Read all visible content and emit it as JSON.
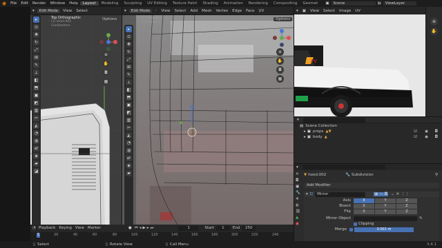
{
  "topbar": {
    "menus": [
      "File",
      "Edit",
      "Render",
      "Window",
      "Help"
    ],
    "workspaces": [
      "Layout",
      "Modeling",
      "Sculpting",
      "UV Editing",
      "Texture Paint",
      "Shading",
      "Animation",
      "Rendering",
      "Compositing",
      "Geomet"
    ],
    "active_workspace": "Layout",
    "scene_label": "Scene",
    "view_layer_label": "ViewLayer"
  },
  "left_viewport": {
    "header": [
      "Edit Mode",
      "View",
      "Select"
    ],
    "title": "Top Orthographic",
    "subtitle1": "(1) hood.002",
    "subtitle2": "Centimeters",
    "options_label": "Options"
  },
  "mid_viewport": {
    "header": [
      "Edit Mode",
      "View",
      "Select",
      "Add",
      "Mesh",
      "Vertex",
      "Edge",
      "Face",
      "UV"
    ],
    "subtitle1": "(1) hood.002",
    "subtitle2": "Centimeters",
    "options_label": "Options"
  },
  "image_editor": {
    "header": [
      "View",
      "Select",
      "Image",
      "UV"
    ],
    "decal_text": "FV"
  },
  "outliner": {
    "header_label": "Scene Collection",
    "items": [
      {
        "name": "props"
      },
      {
        "name": "body"
      }
    ]
  },
  "properties": {
    "object_name": "hood.002",
    "modifier_badge": "Subdivision",
    "add_modifier": "Add Modifier",
    "modifier_name": "Mirror",
    "rows": {
      "axis_label": "Axis",
      "bisect_label": "Bisect",
      "flip_label": "Flip",
      "axes": [
        "X",
        "Y",
        "Z"
      ],
      "mirror_object_label": "Mirror Object",
      "clipping_label": "Clipping",
      "merge_label": "Merge",
      "merge_value": "0.001 m"
    },
    "active_axis": {
      "axis": "X",
      "bisect": "X",
      "flip": "X"
    },
    "accent_color": "#4772b3"
  },
  "timeline": {
    "menus": [
      "Playback",
      "Keying",
      "View",
      "Marker"
    ],
    "current_frame": "1",
    "start_label": "Start",
    "start_value": "1",
    "end_label": "End",
    "end_value": "250",
    "ruler": [
      "1",
      "20",
      "40",
      "60",
      "80",
      "100",
      "120",
      "140",
      "160",
      "180",
      "200",
      "220",
      "240"
    ]
  },
  "statusbar": {
    "select": "Select",
    "rotate": "Rotate View",
    "call_menu": "Call Menu",
    "version": "3.4.1"
  }
}
